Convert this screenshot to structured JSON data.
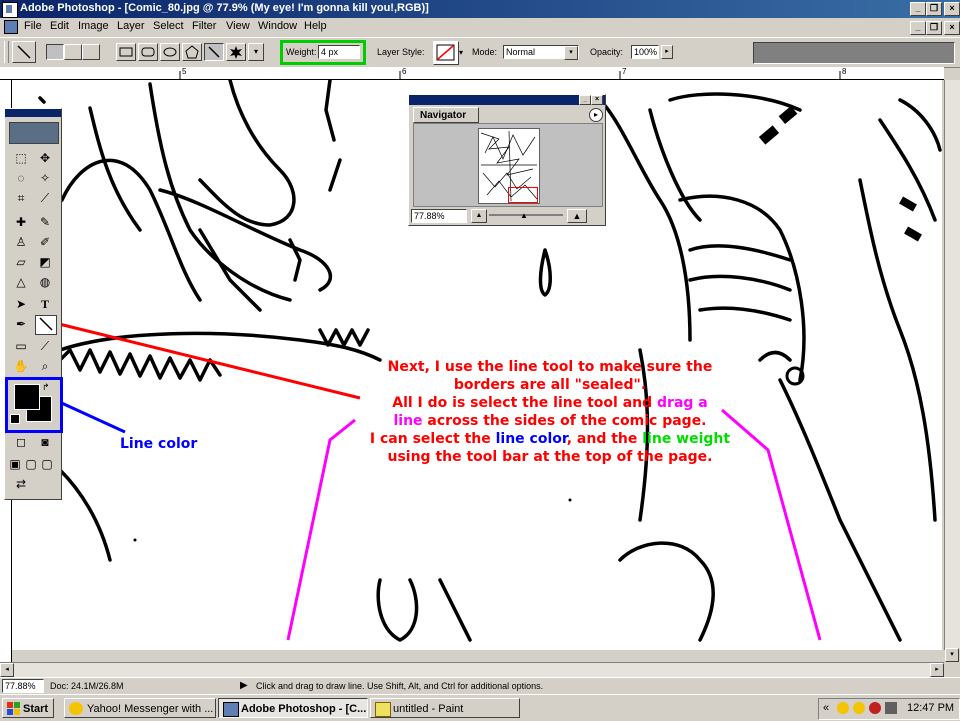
{
  "app": {
    "title": "Adobe Photoshop - [Comic_80.jpg @ 77.9% (My eye! I'm gonna kill you!,RGB)]",
    "window_buttons": [
      "_",
      "❐",
      "×"
    ]
  },
  "menu": [
    "File",
    "Edit",
    "Image",
    "Layer",
    "Select",
    "Filter",
    "View",
    "Window",
    "Help"
  ],
  "options_bar": {
    "weight_label": "Weight:",
    "weight_value": "4 px",
    "layer_style_label": "Layer Style:",
    "mode_label": "Mode:",
    "mode_value": "Normal",
    "opacity_label": "Opacity:",
    "opacity_value": "100%"
  },
  "ruler": {
    "marks": [
      "5",
      "6",
      "7",
      "8"
    ]
  },
  "navigator": {
    "title": "Navigator",
    "zoom": "77.88%"
  },
  "annotations": {
    "line1": "Next, I use the line tool to make sure the",
    "line2": "borders are all \"sealed\".",
    "line3a": "All I do is select the line tool and ",
    "line3b": "drag a",
    "line4a": "line",
    "line4b": " across the sides of the comic page.",
    "line5a": "I can select the ",
    "line5b": "line color",
    "line5c": ", and the ",
    "line5d": "line weight",
    "line6": "using the tool bar at the top of the page.",
    "line_color_label": "Line color",
    "colors": {
      "red": "#ff0000",
      "magenta": "#ff00ff",
      "blue": "#0000ff",
      "green": "#00dd00",
      "highlight": "#00cc00"
    }
  },
  "status": {
    "zoom": "77.88%",
    "doc": "Doc: 24.1M/26.8M",
    "hint": "Click and drag to draw line.  Use Shift, Alt, and Ctrl for additional options."
  },
  "taskbar": {
    "start": "Start",
    "tasks": [
      "Yahoo! Messenger with ...",
      "Adobe Photoshop - [C...",
      "untitled - Paint"
    ],
    "clock": "12:47 PM",
    "tray_chevron": "«"
  }
}
